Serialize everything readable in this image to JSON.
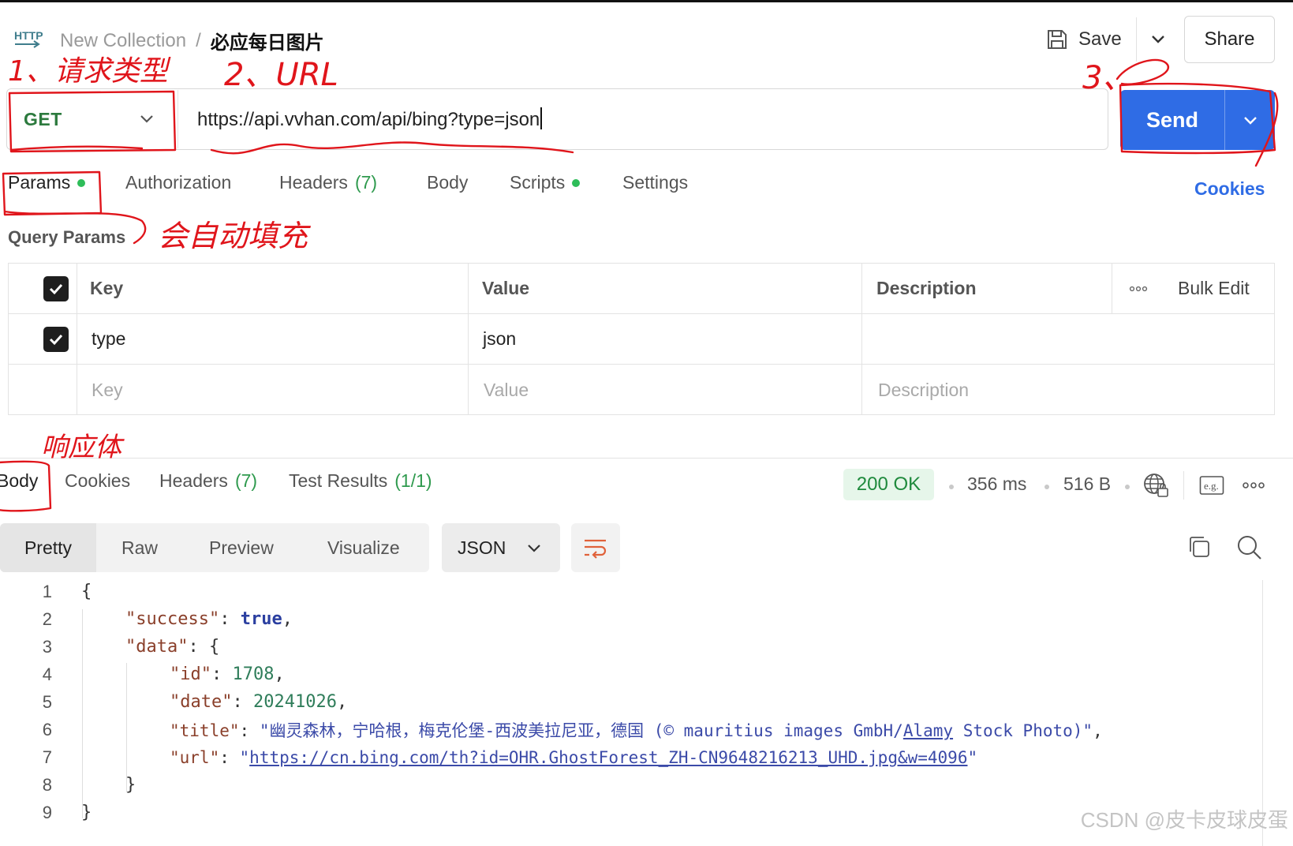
{
  "header": {
    "method_icon_label": "HTTP",
    "breadcrumb_parent": "New Collection",
    "breadcrumb_separator": "/",
    "request_name": "必应每日图片",
    "save_label": "Save",
    "share_label": "Share"
  },
  "request": {
    "method": "GET",
    "url": "https://api.vvhan.com/api/bing?type=json",
    "send_label": "Send"
  },
  "request_tabs": {
    "params": "Params",
    "authorization": "Authorization",
    "headers": "Headers",
    "headers_count": "(7)",
    "body": "Body",
    "scripts": "Scripts",
    "settings": "Settings",
    "cookies": "Cookies"
  },
  "params": {
    "title": "Query Params",
    "columns": {
      "key": "Key",
      "value": "Value",
      "description": "Description"
    },
    "bulk_edit": "Bulk Edit",
    "rows": [
      {
        "key": "type",
        "value": "json",
        "checked": true
      }
    ],
    "placeholder": {
      "key": "Key",
      "value": "Value",
      "description": "Description"
    }
  },
  "response_tabs": {
    "body": "Body",
    "cookies": "Cookies",
    "headers": "Headers",
    "headers_count": "(7)",
    "tests": "Test Results",
    "tests_count": "(1/1)"
  },
  "response_meta": {
    "status": "200 OK",
    "time": "356 ms",
    "size": "516 B",
    "example_icon_label": "e.g."
  },
  "format": {
    "tabs": [
      "Pretty",
      "Raw",
      "Preview",
      "Visualize"
    ],
    "language": "JSON"
  },
  "code": {
    "line_numbers": [
      "1",
      "2",
      "3",
      "4",
      "5",
      "6",
      "7",
      "8",
      "9"
    ],
    "l1": "{",
    "l2_key": "\"success\"",
    "l2_colon": ": ",
    "l2_val": "true",
    "l2_end": ",",
    "l3_key": "\"data\"",
    "l3_rest": ": {",
    "l4_key": "\"id\"",
    "l4_colon": ": ",
    "l4_val": "1708",
    "l4_end": ",",
    "l5_key": "\"date\"",
    "l5_colon": ": ",
    "l5_val": "20241026",
    "l5_end": ",",
    "l6_key": "\"title\"",
    "l6_colon": ": ",
    "l6_val_a": "\"幽灵森林，宁哈根，梅克伦堡-西波美拉尼亚，德国 (© mauritius images GmbH/",
    "l6_val_link": "Alamy",
    "l6_val_b": " Stock Photo)\"",
    "l6_end": ",",
    "l7_key": "\"url\"",
    "l7_colon": ": ",
    "l7_q1": "\"",
    "l7_link": "https://cn.bing.com/th?id=OHR.GhostForest_ZH-CN9648216213_UHD.jpg&w=4096",
    "l7_q2": "\"",
    "l8": "}",
    "l9": "}"
  },
  "annotations": {
    "a1": "1、请求类型",
    "a2": "2、URL",
    "a3": "3、",
    "a4": "会自动填充",
    "a5": "响应体"
  },
  "watermark": "CSDN @皮卡皮球皮蛋"
}
